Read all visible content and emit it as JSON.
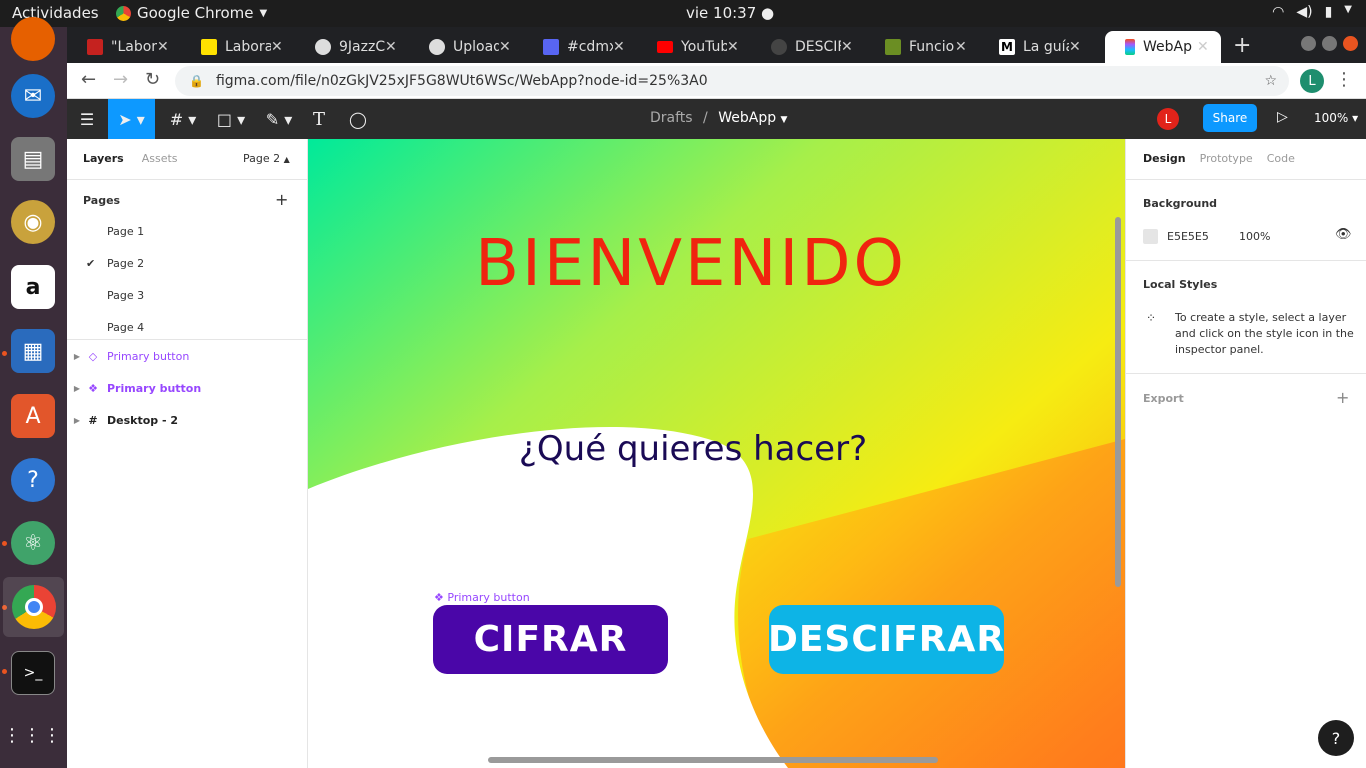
{
  "os": {
    "activities": "Actividades",
    "app_name": "Google Chrome",
    "clock": "vie 10:37"
  },
  "browser": {
    "tabs": [
      {
        "label": "\"Labora",
        "favicon": "gmail-icon",
        "color": "#c5221f"
      },
      {
        "label": "Labora",
        "favicon": "laboratoria-icon",
        "color": "#ffe200"
      },
      {
        "label": "9JazzC",
        "favicon": "github-icon",
        "color": "#333333"
      },
      {
        "label": "Upload",
        "favicon": "github-icon",
        "color": "#333333"
      },
      {
        "label": "#cdmx",
        "favicon": "discord-icon",
        "color": "#5865f2"
      },
      {
        "label": "YouTub",
        "favicon": "youtube-icon",
        "color": "#ff0000"
      },
      {
        "label": "DESCIF",
        "favicon": "blank-icon",
        "color": "#444444"
      },
      {
        "label": "Funcion",
        "favicon": "site-icon",
        "color": "#6b8e23"
      },
      {
        "label": "La guía",
        "favicon": "medium-icon",
        "color": "#111111"
      },
      {
        "label": "WebAp",
        "favicon": "figma-icon",
        "color": "#a259ff"
      }
    ],
    "url": "figma.com/file/n0zGkJV25xJF5G8WUt6WSc/WebApp?node-id=25%3A0",
    "profile_initial": "L"
  },
  "figma": {
    "breadcrumb_parent": "Drafts",
    "breadcrumb_separator": "/",
    "file_name": "WebApp",
    "user_initial": "L",
    "share_label": "Share",
    "zoom": "100%"
  },
  "left_panel": {
    "tab_layers": "Layers",
    "tab_assets": "Assets",
    "current_page": "Page 2",
    "pages_heading": "Pages",
    "pages": [
      "Page 1",
      "Page 2",
      "Page 3",
      "Page 4"
    ],
    "layers": [
      {
        "name": "Primary button",
        "icon": "component-outline-icon"
      },
      {
        "name": "Primary button",
        "icon": "component-icon"
      },
      {
        "name": "Desktop - 2",
        "icon": "frame-icon"
      }
    ]
  },
  "canvas": {
    "title": "BIENVENIDO",
    "question": "¿Qué quieres hacer?",
    "selection_tag": "Primary button",
    "btn_encrypt": "CIFRAR",
    "btn_decrypt": "DESCIFRAR",
    "colors": {
      "title": "#f0240f",
      "encrypt_bg": "#4a06a8",
      "decrypt_bg": "#0db4e6"
    }
  },
  "right_panel": {
    "tab_design": "Design",
    "tab_prototype": "Prototype",
    "tab_code": "Code",
    "background_heading": "Background",
    "bg_hex": "E5E5E5",
    "bg_opacity": "100%",
    "local_styles_heading": "Local Styles",
    "local_styles_hint": "To create a style, select a layer and click on the style icon in the inspector panel.",
    "export_heading": "Export"
  }
}
